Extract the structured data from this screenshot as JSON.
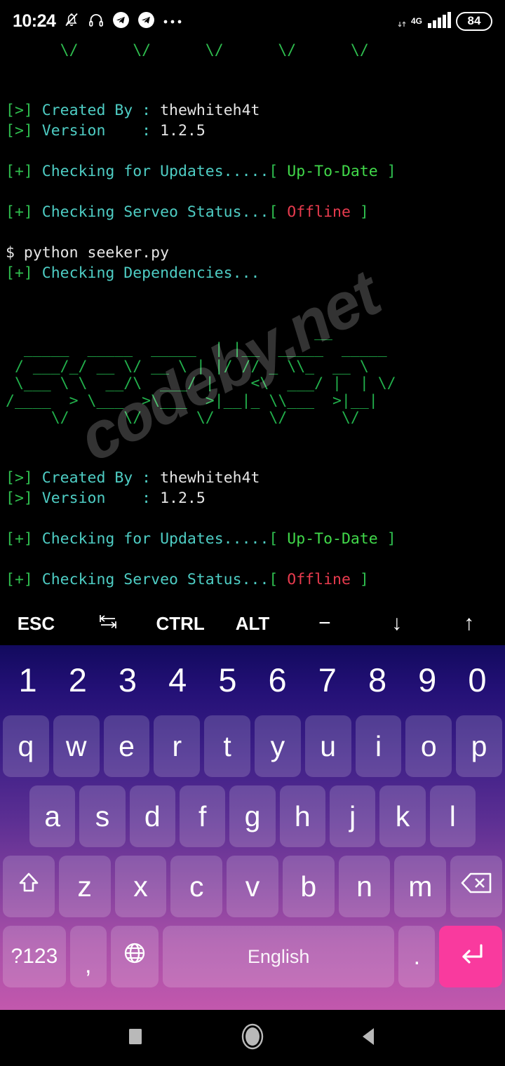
{
  "status_bar": {
    "time": "10:24",
    "icons": [
      "bell-off-icon",
      "headphones-icon",
      "telegram-icon",
      "telegram-icon",
      "more-dots-icon"
    ],
    "network_type": "4G",
    "battery_level": "84"
  },
  "terminal": {
    "prompt_symbol": "$",
    "banner_tail_line": "      \\/      \\/      \\/      \\/      \\/",
    "session_1": {
      "created_by_tag": "[>]",
      "created_by_label": "Created By :",
      "created_by_value": "thewhiteh4t",
      "version_tag": "[>]",
      "version_label": "Version    :",
      "version_value": "1.2.5",
      "updates_tag": "[+]",
      "updates_label": "Checking for Updates.....",
      "updates_status": "Up-To-Date",
      "serveo_tag": "[+]",
      "serveo_label": "Checking Serveo Status...",
      "serveo_status": "Offline"
    },
    "command_line": "python seeker.py",
    "deps_tag": "[+]",
    "deps_label": "Checking Dependencies...",
    "banner_art": [
      "                                  __                            ",
      "  _____  _____  _____  | |__  _____  _____ ",
      " / ___/_/ __ \\/ __ \\ | |/ // _ \\\\_  __ \\",
      " \\___ \\ \\  __/\\  ___/ |    <\\  ___/ |  | \\/",
      "/____  > \\___  >\\___  >|__|_ \\\\___  >|__|   ",
      "     \\/      \\/      \\/      \\/      \\/     "
    ],
    "session_2": {
      "created_by_tag": "[>]",
      "created_by_label": "Created By :",
      "created_by_value": "thewhiteh4t",
      "version_tag": "[>]",
      "version_label": "Version    :",
      "version_value": "1.2.5",
      "updates_tag": "[+]",
      "updates_label": "Checking for Updates.....",
      "updates_status": "Up-To-Date",
      "serveo_tag": "[+]",
      "serveo_label": "Checking Serveo Status...",
      "serveo_status": "Offline"
    },
    "colors": {
      "tag_green": "#2fbf4f",
      "label_cyan": "#4ecdc4",
      "value_white": "#e6e6e6",
      "ok_green": "#41d94a",
      "error_red": "#e83b4e",
      "banner_green": "#22b14c"
    }
  },
  "watermark": {
    "text": "codeby.net"
  },
  "extra_keys": [
    {
      "label": "ESC",
      "name": "esc"
    },
    {
      "label": "",
      "name": "tab"
    },
    {
      "label": "CTRL",
      "name": "ctrl"
    },
    {
      "label": "ALT",
      "name": "alt"
    },
    {
      "label": "−",
      "name": "minus"
    },
    {
      "label": "↓",
      "name": "arrow-down"
    },
    {
      "label": "↑",
      "name": "arrow-up"
    }
  ],
  "keyboard": {
    "accent_enter": "#f93a9e",
    "row_numbers": [
      "1",
      "2",
      "3",
      "4",
      "5",
      "6",
      "7",
      "8",
      "9",
      "0"
    ],
    "row_q": [
      "q",
      "w",
      "e",
      "r",
      "t",
      "y",
      "u",
      "i",
      "o",
      "p"
    ],
    "row_a": [
      "a",
      "s",
      "d",
      "f",
      "g",
      "h",
      "j",
      "k",
      "l"
    ],
    "row_z": [
      "z",
      "x",
      "c",
      "v",
      "b",
      "n",
      "m"
    ],
    "bottom": {
      "symbols_label": "?123",
      "comma_label": ",",
      "globe_label": "",
      "space_label": "English",
      "period_label": ".",
      "enter_label": ""
    }
  },
  "nav_bar": {
    "recents": "recents-square",
    "home": "home-circle",
    "back": "back-triangle"
  }
}
